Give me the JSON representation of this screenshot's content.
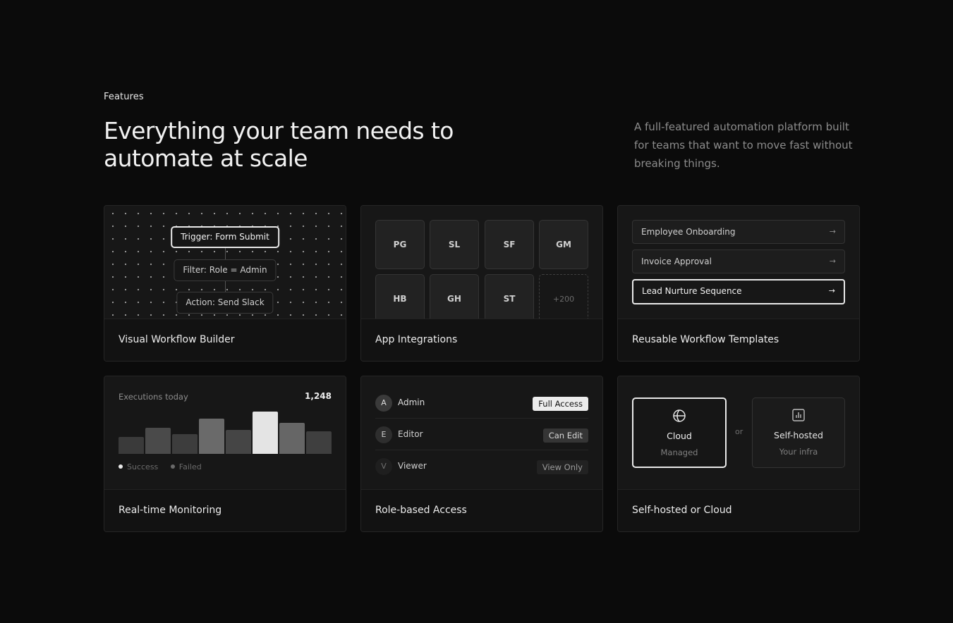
{
  "header": {
    "eyebrow": "Features",
    "title": "Everything your team needs to automate at scale",
    "description": "A full-featured automation platform built for teams that want to move fast without breaking things."
  },
  "cards": {
    "builder": {
      "caption": "Visual Workflow Builder",
      "nodes": [
        "Trigger: Form Submit",
        "Filter: Role = Admin",
        "Action: Send Slack"
      ]
    },
    "integrations": {
      "caption": "App Integrations",
      "apps": [
        "PG",
        "SL",
        "SF",
        "GM",
        "HB",
        "GH",
        "ST"
      ],
      "more": "+200"
    },
    "templates": {
      "caption": "Reusable Workflow Templates",
      "items": [
        {
          "label": "Employee Onboarding",
          "arrow": "→"
        },
        {
          "label": "Invoice Approval",
          "arrow": "→"
        },
        {
          "label": "Lead Nurture Sequence",
          "arrow": "→"
        }
      ]
    },
    "monitoring": {
      "caption": "Real-time Monitoring",
      "label": "Executions today",
      "value": "1,248",
      "bar_levels": [
        0.38,
        0.58,
        0.44,
        0.78,
        0.53,
        0.94,
        0.69,
        0.5
      ],
      "highlight_index": 5,
      "legend": [
        "Success",
        "Failed"
      ]
    },
    "roles": {
      "caption": "Role-based Access",
      "items": [
        {
          "initial": "A",
          "name": "Admin",
          "badge": "Full Access"
        },
        {
          "initial": "E",
          "name": "Editor",
          "badge": "Can Edit"
        },
        {
          "initial": "V",
          "name": "Viewer",
          "badge": "View Only"
        }
      ]
    },
    "deploy": {
      "caption": "Self-hosted or Cloud",
      "or": "or",
      "options": [
        {
          "title": "Cloud",
          "subtitle": "Managed",
          "icon": "globe-icon"
        },
        {
          "title": "Self-hosted",
          "subtitle": "Your infra",
          "icon": "server-chart-icon"
        }
      ]
    }
  },
  "colors": {
    "background": "#0b0b0b",
    "card": "#141414",
    "accent": "#e9e9e9",
    "muted": "#8c8c8c"
  }
}
